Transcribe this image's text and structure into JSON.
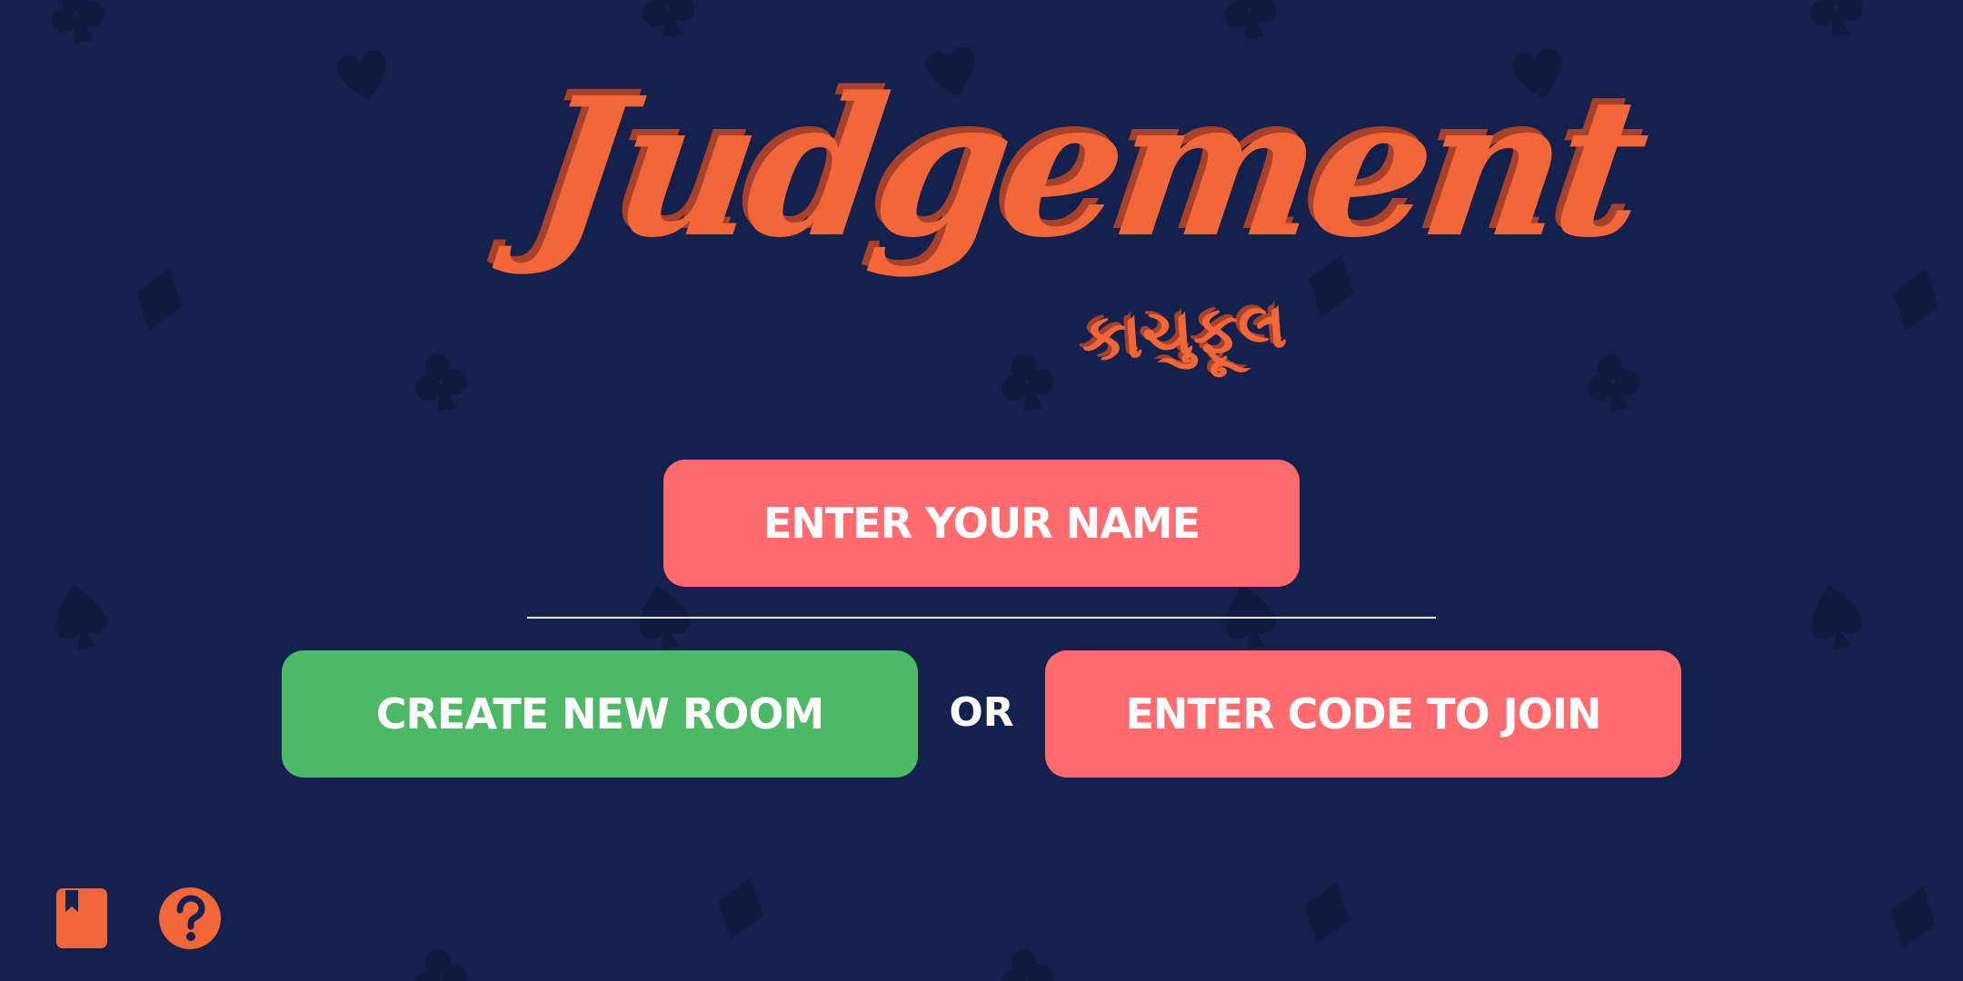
{
  "theme": {
    "background": "#14214d",
    "pattern_color": "#0f1a40",
    "logo_color": "#f2673a",
    "logo_shadow": "#a9412a",
    "primary_button": "#ff6b6f",
    "create_button": "#4db866",
    "icon_color": "#f2673a"
  },
  "logo": {
    "title": "Judgement",
    "subtitle": "કાચુફૂલ"
  },
  "form": {
    "name_button_label": "ENTER YOUR NAME",
    "create_room_label": "CREATE NEW ROOM",
    "or_label": "OR",
    "join_label": "ENTER CODE TO JOIN"
  },
  "footer": {
    "rules_icon": "book-icon",
    "help_icon": "help-icon"
  },
  "background_pattern": {
    "suits": [
      "heart",
      "diamond",
      "club",
      "spade"
    ]
  }
}
